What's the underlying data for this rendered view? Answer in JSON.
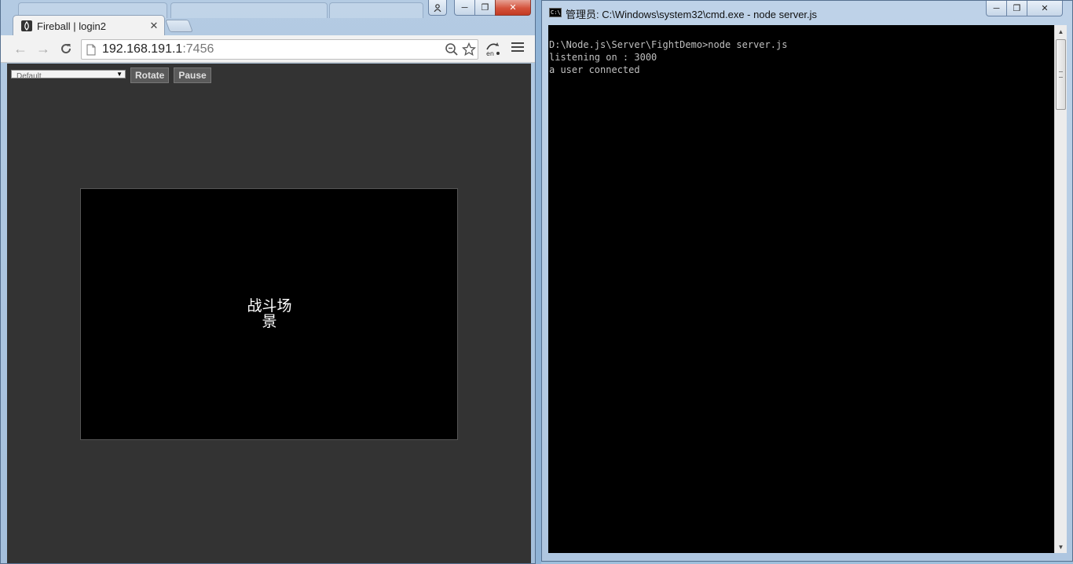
{
  "browser": {
    "tab_title": "Fireball | login2",
    "url_host": "192.168.191.1",
    "url_port": ":7456",
    "controls": {
      "device_select_value": "Default",
      "rotate_label": "Rotate",
      "pause_label": "Pause"
    },
    "scene_label": "战斗场景",
    "colors": {
      "viewport_bg": "#333333",
      "stage_bg": "#000000"
    }
  },
  "cmd": {
    "title": "管理员: C:\\Windows\\system32\\cmd.exe - node  server.js",
    "lines": [
      "D:\\Node.js\\Server\\FightDemo>node server.js",
      "listening on : 3000",
      "a user connected"
    ]
  }
}
